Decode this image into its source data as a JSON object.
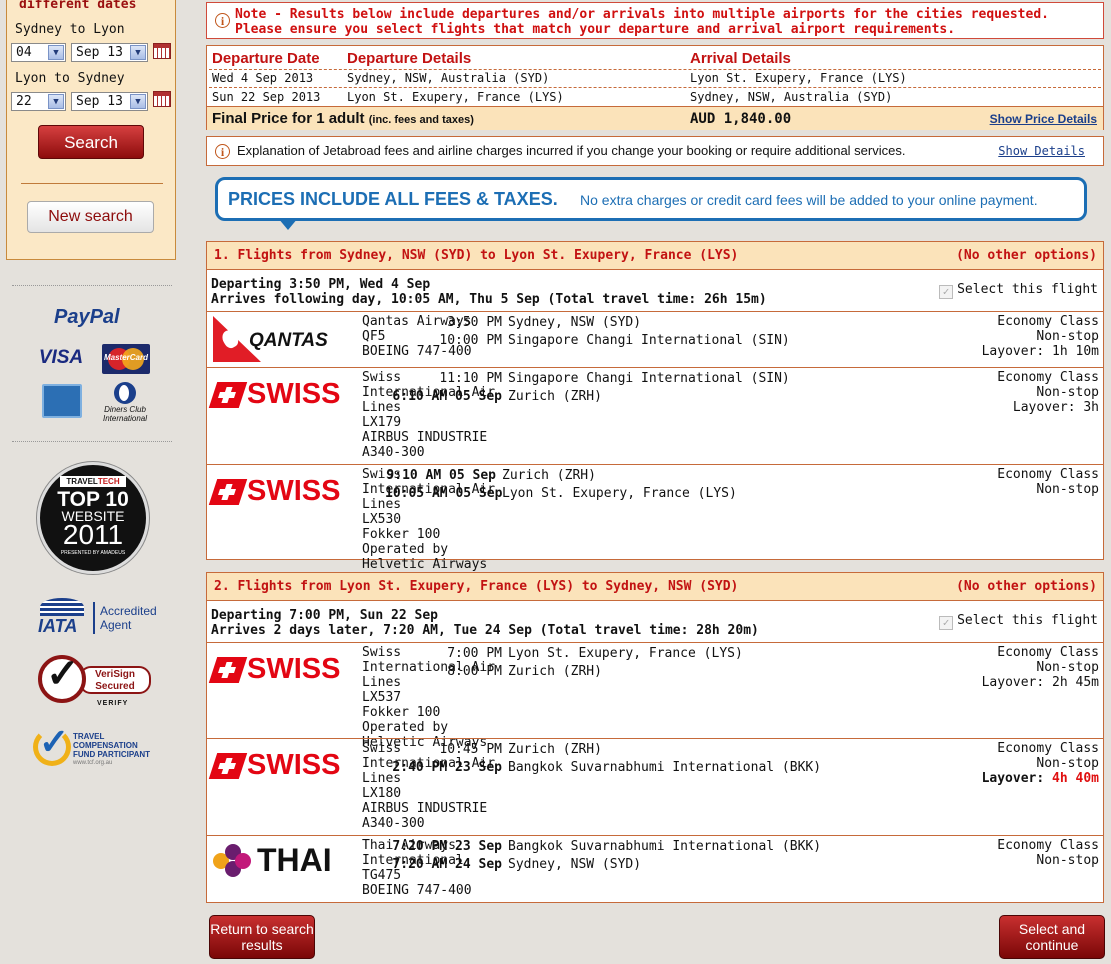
{
  "search_panel": {
    "heading": "different dates",
    "outbound": {
      "route": "Sydney to Lyon",
      "day": "04",
      "month": "Sep 13"
    },
    "inbound": {
      "route": "Lyon to Sydney",
      "day": "22",
      "month": "Sep 13"
    },
    "search_label": "Search",
    "new_search_label": "New search"
  },
  "payments": {
    "paypal": "PayPal",
    "visa": "VISA",
    "mastercard": "MasterCard",
    "diners": "Diners Club International"
  },
  "badges": {
    "top10": {
      "tag_left": "TRAVEL",
      "tag_right": "TECH",
      "line1": "TOP 10",
      "line2": "WEBSITE",
      "year": "2011",
      "presented": "PRESENTED BY AMADEUS"
    },
    "iata": {
      "word": "IATA",
      "line1": "Accredited",
      "line2": "Agent"
    },
    "verisign": {
      "line1": "VeriSign",
      "line2": "Secured",
      "verify": "VERIFY"
    },
    "tcf": {
      "line1": "TRAVEL",
      "line2": "COMPENSATION",
      "line3": "FUND PARTICIPANT",
      "url": "www.tcf.org.au"
    }
  },
  "note": {
    "text": "Note - Results below include departures and/or arrivals into multiple airports for the cities requested. Please ensure you select flights that match your departure and arrival airport requirements."
  },
  "summary": {
    "headers": {
      "date": "Departure Date",
      "details": "Departure Details",
      "arrival": "Arrival Details"
    },
    "rows": [
      {
        "date": "Wed 4 Sep 2013",
        "departure": "Sydney, NSW, Australia (SYD)",
        "arrival": "Lyon St. Exupery, France (LYS)"
      },
      {
        "date": "Sun 22 Sep 2013",
        "departure": "Lyon St. Exupery, France (LYS)",
        "arrival": "Sydney, NSW, Australia (SYD)"
      }
    ],
    "final_price_label": "Final Price for 1 adult",
    "final_price_note": "(inc. fees and taxes)",
    "final_price": "AUD 1,840.00",
    "show_price_details": "Show Price Details"
  },
  "fees": {
    "text": "Explanation of Jetabroad fees and airline charges incurred if you change your booking or require additional services.",
    "link": "Show Details"
  },
  "banner": {
    "headline": "PRICES INCLUDE ALL FEES & TAXES.",
    "subline": "No extra charges or credit card fees will be added to your online payment."
  },
  "flights": [
    {
      "title": "1. Flights from Sydney, NSW (SYD) to Lyon St. Exupery, France (LYS)",
      "options": "(No other options)",
      "departing": "Departing 3:50 PM, Wed 4 Sep",
      "arrives": "Arrives following day, 10:05 AM, Thu 5 Sep (Total travel time: 26h 15m)",
      "select_label": "Select this flight",
      "segments": [
        {
          "logo": "qantas",
          "airline": "Qantas Airways",
          "flight": "QF5",
          "equipment": "BOEING 747-400",
          "dep_time": "3:50 PM",
          "dep_place": "Sydney, NSW (SYD)",
          "arr_time": "10:00 PM",
          "arr_place": "Singapore Changi International (SIN)",
          "cabin": "Economy Class",
          "stops": "Non-stop",
          "layover": "Layover: 1h 10m"
        },
        {
          "logo": "swiss",
          "airline": "Swiss International Air Lines",
          "flight": "LX179",
          "equipment": "AIRBUS INDUSTRIE A340-300",
          "dep_time": "11:10 PM",
          "dep_place": "Singapore Changi International (SIN)",
          "arr_time": "6:10 AM 05 Sep",
          "arr_place": "Zurich (ZRH)",
          "cabin": "Economy Class",
          "stops": "Non-stop",
          "layover": "Layover: 3h"
        },
        {
          "logo": "swiss",
          "airline": "Swiss International Air Lines",
          "flight": "LX530",
          "equipment": "Fokker 100 Operated by Helvetic Airways",
          "dep_time": "9:10 AM 05 Sep",
          "dep_place": "Zurich (ZRH)",
          "arr_time": "10:05 AM 05 Sep",
          "arr_place": "Lyon St. Exupery, France (LYS)",
          "cabin": "Economy Class",
          "stops": "Non-stop",
          "layover": ""
        }
      ]
    },
    {
      "title": "2. Flights from Lyon St. Exupery, France (LYS) to Sydney, NSW (SYD)",
      "options": "(No other options)",
      "departing": "Departing 7:00 PM, Sun 22 Sep",
      "arrives": "Arrives 2 days later, 7:20 AM, Tue 24 Sep (Total travel time: 28h 20m)",
      "select_label": "Select this flight",
      "segments": [
        {
          "logo": "swiss",
          "airline": "Swiss International Air Lines",
          "flight": "LX537",
          "equipment": "Fokker 100 Operated by Helvetic Airways",
          "dep_time": "7:00 PM",
          "dep_place": "Lyon St. Exupery, France (LYS)",
          "arr_time": "8:00 PM",
          "arr_place": "Zurich (ZRH)",
          "cabin": "Economy Class",
          "stops": "Non-stop",
          "layover": "Layover: 2h 45m"
        },
        {
          "logo": "swiss",
          "airline": "Swiss International Air Lines",
          "flight": "LX180",
          "equipment": "AIRBUS INDUSTRIE A340-300",
          "dep_time": "10:45 PM",
          "dep_place": "Zurich (ZRH)",
          "arr_time": "2:40 PM 23 Sep",
          "arr_place": "Bangkok Suvarnabhumi International (BKK)",
          "cabin": "Economy Class",
          "stops": "Non-stop",
          "layover_label": "Layover:",
          "layover_value": "4h 40m"
        },
        {
          "logo": "thai",
          "airline": "Thai Airways International",
          "flight": "TG475",
          "equipment": "BOEING 747-400",
          "dep_time": "7:20 PM 23 Sep",
          "dep_place": "Bangkok Suvarnabhumi International (BKK)",
          "arr_time": "7:20 AM 24 Sep",
          "arr_place": "Sydney, NSW (SYD)",
          "cabin": "Economy Class",
          "stops": "Non-stop",
          "layover": ""
        }
      ]
    }
  ],
  "logos": {
    "qantas": "QANTAS",
    "swiss": "SWISS",
    "thai": "THAI"
  },
  "buttons": {
    "return": "Return to search results",
    "continue": "Select and continue"
  },
  "colors": {
    "accent_red": "#c21212",
    "panel_bg": "#fbe8c6",
    "header_bg": "#fbe3ba",
    "link_blue": "#1b3f8b",
    "banner_blue": "#1c6eb4"
  }
}
